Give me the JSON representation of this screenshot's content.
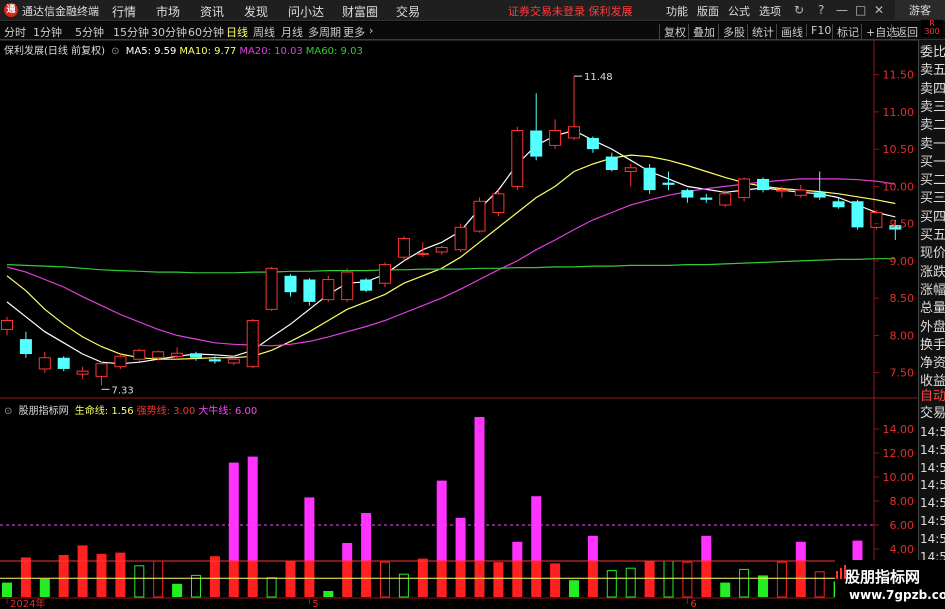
{
  "app": {
    "name": "通达信金融终端",
    "logo_glyph": "通",
    "menus": [
      "行情",
      "市场",
      "资讯",
      "发现",
      "问小达",
      "财富圈",
      "交易"
    ],
    "notice": "证券交易未登录  保利发展",
    "right_menus": [
      "功能",
      "版面",
      "公式",
      "选项"
    ],
    "guest": "游客"
  },
  "periods": {
    "items": [
      "分时",
      "1分钟",
      "5分钟",
      "15分钟",
      "30分钟",
      "60分钟",
      "日线",
      "周线",
      "月线",
      "多周期",
      "更多"
    ],
    "active": "日线"
  },
  "tools": [
    "复权",
    "叠加",
    "多股",
    "统计",
    "画线",
    "F10",
    "标记",
    "+自选",
    "返回"
  ],
  "badge": "R 300",
  "main_chart": {
    "title": "保利发展(日线 前复权)",
    "ma": [
      {
        "label": "MA5: 9.59",
        "color": "#ffffff"
      },
      {
        "label": "MA10: 9.77",
        "color": "#ffff66"
      },
      {
        "label": "MA20: 10.03",
        "color": "#e040e0"
      },
      {
        "label": "MA60: 9.03",
        "color": "#33cc33"
      }
    ],
    "high_label": "11.48",
    "low_label": "7.33"
  },
  "indicator": {
    "name": "股朋指标网",
    "lines": [
      {
        "label": "生命线: 1.56",
        "color": "#ffff66"
      },
      {
        "label": "强势线: 3.00",
        "color": "#ff3333"
      },
      {
        "label": "大牛线: 6.00",
        "color": "#ff44ff"
      }
    ]
  },
  "chart_data": {
    "type": "candlestick",
    "price_axis": {
      "min": 7.2,
      "max": 11.75,
      "ticks": [
        "11.50",
        "11.00",
        "10.50",
        "10.00",
        "9.50",
        "9.00",
        "8.50",
        "8.00",
        "7.50"
      ]
    },
    "indicator_axis": {
      "min": 0,
      "max": 16,
      "ticks": [
        "14.00",
        "12.00",
        "10.00",
        "8.00",
        "6.00",
        "4.00",
        "2.00"
      ]
    },
    "x_labels": [
      {
        "label": "2024年",
        "index": 0
      },
      {
        "label": "5",
        "index": 16
      },
      {
        "label": "6",
        "index": 36
      }
    ],
    "candles": [
      {
        "o": 8.08,
        "c": 8.2,
        "h": 8.25,
        "l": 8.0
      },
      {
        "o": 7.95,
        "c": 7.75,
        "h": 8.05,
        "l": 7.7
      },
      {
        "o": 7.55,
        "c": 7.7,
        "h": 7.78,
        "l": 7.5
      },
      {
        "o": 7.7,
        "c": 7.55,
        "h": 7.72,
        "l": 7.52
      },
      {
        "o": 7.48,
        "c": 7.52,
        "h": 7.58,
        "l": 7.42
      },
      {
        "o": 7.45,
        "c": 7.62,
        "h": 7.65,
        "l": 7.33
      },
      {
        "o": 7.58,
        "c": 7.72,
        "h": 7.75,
        "l": 7.55
      },
      {
        "o": 7.68,
        "c": 7.8,
        "h": 7.82,
        "l": 7.65
      },
      {
        "o": 7.7,
        "c": 7.78,
        "h": 7.8,
        "l": 7.66
      },
      {
        "o": 7.72,
        "c": 7.76,
        "h": 7.84,
        "l": 7.68
      },
      {
        "o": 7.76,
        "c": 7.7,
        "h": 7.78,
        "l": 7.66
      },
      {
        "o": 7.68,
        "c": 7.65,
        "h": 7.72,
        "l": 7.62
      },
      {
        "o": 7.63,
        "c": 7.68,
        "h": 7.72,
        "l": 7.6
      },
      {
        "o": 7.58,
        "c": 8.2,
        "h": 8.22,
        "l": 7.56
      },
      {
        "o": 8.35,
        "c": 8.9,
        "h": 8.92,
        "l": 8.33
      },
      {
        "o": 8.8,
        "c": 8.58,
        "h": 8.82,
        "l": 8.52
      },
      {
        "o": 8.75,
        "c": 8.45,
        "h": 8.77,
        "l": 8.4
      },
      {
        "o": 8.48,
        "c": 8.75,
        "h": 8.8,
        "l": 8.45
      },
      {
        "o": 8.48,
        "c": 8.85,
        "h": 8.9,
        "l": 8.45
      },
      {
        "o": 8.75,
        "c": 8.6,
        "h": 8.77,
        "l": 8.58
      },
      {
        "o": 8.7,
        "c": 8.95,
        "h": 8.98,
        "l": 8.65
      },
      {
        "o": 9.05,
        "c": 9.3,
        "h": 9.33,
        "l": 9.0
      },
      {
        "o": 9.1,
        "c": 9.1,
        "h": 9.25,
        "l": 9.05
      },
      {
        "o": 9.12,
        "c": 9.18,
        "h": 9.2,
        "l": 9.08
      },
      {
        "o": 9.15,
        "c": 9.45,
        "h": 9.5,
        "l": 9.12
      },
      {
        "o": 9.4,
        "c": 9.8,
        "h": 9.85,
        "l": 9.38
      },
      {
        "o": 9.65,
        "c": 9.9,
        "h": 9.95,
        "l": 9.6
      },
      {
        "o": 10.0,
        "c": 10.75,
        "h": 10.8,
        "l": 9.95
      },
      {
        "o": 10.75,
        "c": 10.4,
        "h": 11.25,
        "l": 10.35
      },
      {
        "o": 10.55,
        "c": 10.75,
        "h": 10.9,
        "l": 10.5
      },
      {
        "o": 10.65,
        "c": 10.8,
        "h": 11.48,
        "l": 10.62
      },
      {
        "o": 10.65,
        "c": 10.5,
        "h": 10.67,
        "l": 10.45
      },
      {
        "o": 10.4,
        "c": 10.22,
        "h": 10.45,
        "l": 10.2
      },
      {
        "o": 10.2,
        "c": 10.25,
        "h": 10.3,
        "l": 10.0
      },
      {
        "o": 10.25,
        "c": 9.95,
        "h": 10.3,
        "l": 9.9
      },
      {
        "o": 10.05,
        "c": 10.02,
        "h": 10.2,
        "l": 9.95
      },
      {
        "o": 9.95,
        "c": 9.85,
        "h": 9.97,
        "l": 9.78
      },
      {
        "o": 9.85,
        "c": 9.82,
        "h": 9.9,
        "l": 9.78
      },
      {
        "o": 9.75,
        "c": 9.9,
        "h": 9.95,
        "l": 9.72
      },
      {
        "o": 9.85,
        "c": 10.1,
        "h": 10.12,
        "l": 9.8
      },
      {
        "o": 10.1,
        "c": 9.95,
        "h": 10.12,
        "l": 9.92
      },
      {
        "o": 9.95,
        "c": 9.95,
        "h": 10.0,
        "l": 9.85
      },
      {
        "o": 9.88,
        "c": 9.95,
        "h": 10.02,
        "l": 9.85
      },
      {
        "o": 9.92,
        "c": 9.85,
        "h": 10.2,
        "l": 9.82
      },
      {
        "o": 9.8,
        "c": 9.72,
        "h": 9.85,
        "l": 9.7
      },
      {
        "o": 9.8,
        "c": 9.45,
        "h": 9.82,
        "l": 9.42
      },
      {
        "o": 9.45,
        "c": 9.65,
        "h": 9.68,
        "l": 9.42
      },
      {
        "o": 9.48,
        "c": 9.42,
        "h": 9.55,
        "l": 9.28
      }
    ],
    "ma_series": [
      {
        "name": "MA5",
        "color": "#ffffff",
        "values": [
          8.45,
          8.25,
          8.05,
          7.9,
          7.75,
          7.64,
          7.62,
          7.64,
          7.68,
          7.72,
          7.75,
          7.74,
          7.72,
          7.8,
          7.98,
          8.15,
          8.35,
          8.55,
          8.7,
          8.72,
          8.82,
          9.0,
          9.15,
          9.25,
          9.4,
          9.7,
          9.95,
          10.3,
          10.55,
          10.68,
          10.75,
          10.62,
          10.5,
          10.35,
          10.2,
          10.1,
          10.0,
          9.96,
          9.92,
          9.95,
          9.98,
          9.95,
          9.92,
          9.9,
          9.85,
          9.75,
          9.65,
          9.59
        ]
      },
      {
        "name": "MA10",
        "color": "#ffff66",
        "values": [
          8.8,
          8.6,
          8.35,
          8.15,
          7.98,
          7.85,
          7.75,
          7.7,
          7.68,
          7.68,
          7.69,
          7.7,
          7.7,
          7.72,
          7.8,
          7.92,
          8.05,
          8.2,
          8.35,
          8.45,
          8.55,
          8.7,
          8.8,
          8.9,
          9.05,
          9.25,
          9.45,
          9.65,
          9.85,
          10.0,
          10.2,
          10.3,
          10.38,
          10.42,
          10.4,
          10.35,
          10.28,
          10.2,
          10.12,
          10.05,
          10.0,
          9.97,
          9.95,
          9.93,
          9.9,
          9.86,
          9.82,
          9.77
        ]
      },
      {
        "name": "MA20",
        "color": "#e040e0",
        "values": [
          8.92,
          8.85,
          8.75,
          8.65,
          8.52,
          8.4,
          8.28,
          8.18,
          8.08,
          8.0,
          7.95,
          7.9,
          7.88,
          7.87,
          7.86,
          7.88,
          7.92,
          7.98,
          8.05,
          8.12,
          8.2,
          8.3,
          8.4,
          8.5,
          8.62,
          8.75,
          8.88,
          9.0,
          9.15,
          9.28,
          9.42,
          9.55,
          9.65,
          9.75,
          9.82,
          9.88,
          9.93,
          9.97,
          10.0,
          10.03,
          10.06,
          10.08,
          10.1,
          10.1,
          10.1,
          10.09,
          10.07,
          10.03
        ]
      },
      {
        "name": "MA60",
        "color": "#33cc33",
        "values": [
          8.95,
          8.94,
          8.93,
          8.92,
          8.9,
          8.88,
          8.87,
          8.86,
          8.85,
          8.85,
          8.84,
          8.84,
          8.84,
          8.85,
          8.85,
          8.86,
          8.86,
          8.87,
          8.87,
          8.87,
          8.88,
          8.88,
          8.89,
          8.89,
          8.89,
          8.9,
          8.9,
          8.91,
          8.91,
          8.92,
          8.92,
          8.93,
          8.93,
          8.94,
          8.94,
          8.94,
          8.95,
          8.95,
          8.96,
          8.97,
          8.98,
          8.99,
          9.0,
          9.01,
          9.02,
          9.02,
          9.03,
          9.03
        ]
      }
    ],
    "indicator_bars": [
      {
        "v": 1.2,
        "k": "green"
      },
      {
        "v": 3.3,
        "k": "red"
      },
      {
        "v": 1.5,
        "k": "green"
      },
      {
        "v": 3.5,
        "k": "red"
      },
      {
        "v": 4.3,
        "k": "red"
      },
      {
        "v": 3.6,
        "k": "red"
      },
      {
        "v": 3.7,
        "k": "red"
      },
      {
        "v": 2.6,
        "k": "green-hollow"
      },
      {
        "v": 3.0,
        "k": "red-hollow"
      },
      {
        "v": 1.1,
        "k": "green"
      },
      {
        "v": 1.8,
        "k": "green-hollow"
      },
      {
        "v": 3.4,
        "k": "red"
      },
      {
        "v": 11.2,
        "k": "magenta"
      },
      {
        "v": 11.7,
        "k": "magenta"
      },
      {
        "v": 1.6,
        "k": "green-hollow"
      },
      {
        "v": 3.0,
        "k": "red"
      },
      {
        "v": 8.3,
        "k": "magenta"
      },
      {
        "v": 0.5,
        "k": "green"
      },
      {
        "v": 4.5,
        "k": "magenta"
      },
      {
        "v": 7.0,
        "k": "magenta"
      },
      {
        "v": 2.9,
        "k": "red-hollow"
      },
      {
        "v": 1.9,
        "k": "green-hollow"
      },
      {
        "v": 3.2,
        "k": "red"
      },
      {
        "v": 9.7,
        "k": "magenta"
      },
      {
        "v": 6.6,
        "k": "magenta"
      },
      {
        "v": 15.0,
        "k": "magenta"
      },
      {
        "v": 2.9,
        "k": "red"
      },
      {
        "v": 4.6,
        "k": "magenta"
      },
      {
        "v": 8.4,
        "k": "magenta"
      },
      {
        "v": 2.8,
        "k": "red"
      },
      {
        "v": 1.4,
        "k": "green"
      },
      {
        "v": 5.1,
        "k": "magenta"
      },
      {
        "v": 2.2,
        "k": "green-hollow"
      },
      {
        "v": 2.4,
        "k": "green-hollow"
      },
      {
        "v": 3.0,
        "k": "red"
      },
      {
        "v": 3.0,
        "k": "green-hollow"
      },
      {
        "v": 2.9,
        "k": "red-hollow"
      },
      {
        "v": 5.1,
        "k": "magenta"
      },
      {
        "v": 1.2,
        "k": "green"
      },
      {
        "v": 2.3,
        "k": "green-hollow"
      },
      {
        "v": 1.8,
        "k": "green"
      },
      {
        "v": 2.9,
        "k": "red-hollow"
      },
      {
        "v": 4.6,
        "k": "magenta"
      },
      {
        "v": 2.1,
        "k": "red-hollow"
      },
      {
        "v": 1.3,
        "k": "green"
      },
      {
        "v": 4.7,
        "k": "magenta"
      },
      {
        "v": 2.2,
        "k": "green-hollow"
      }
    ],
    "ref_lines": [
      {
        "name": "生命线",
        "value": 1.56,
        "color": "#ffff66"
      },
      {
        "name": "强势线",
        "value": 3.0,
        "color": "#ff3333"
      },
      {
        "name": "大牛线",
        "value": 6.0,
        "color": "#ff44ff"
      }
    ]
  },
  "side_panel": {
    "items": [
      "委比",
      "卖五",
      "卖四",
      "卖三",
      "卖二",
      "卖一",
      "买一",
      "买二",
      "买三",
      "买四",
      "买五",
      "现价",
      "涨跌",
      "涨幅",
      "总量",
      "外盘",
      "换手",
      "净资",
      "收益"
    ],
    "auto_label": "自动",
    "trade_label": "交易",
    "times": [
      "14:56",
      "14:56",
      "14:56",
      "14:56",
      "14:56",
      "14:56",
      "14:56",
      "14:56",
      "14:56",
      "14:56"
    ]
  },
  "watermark": {
    "line1": "股朋指标网",
    "line2": "www.7gpzb.com"
  }
}
